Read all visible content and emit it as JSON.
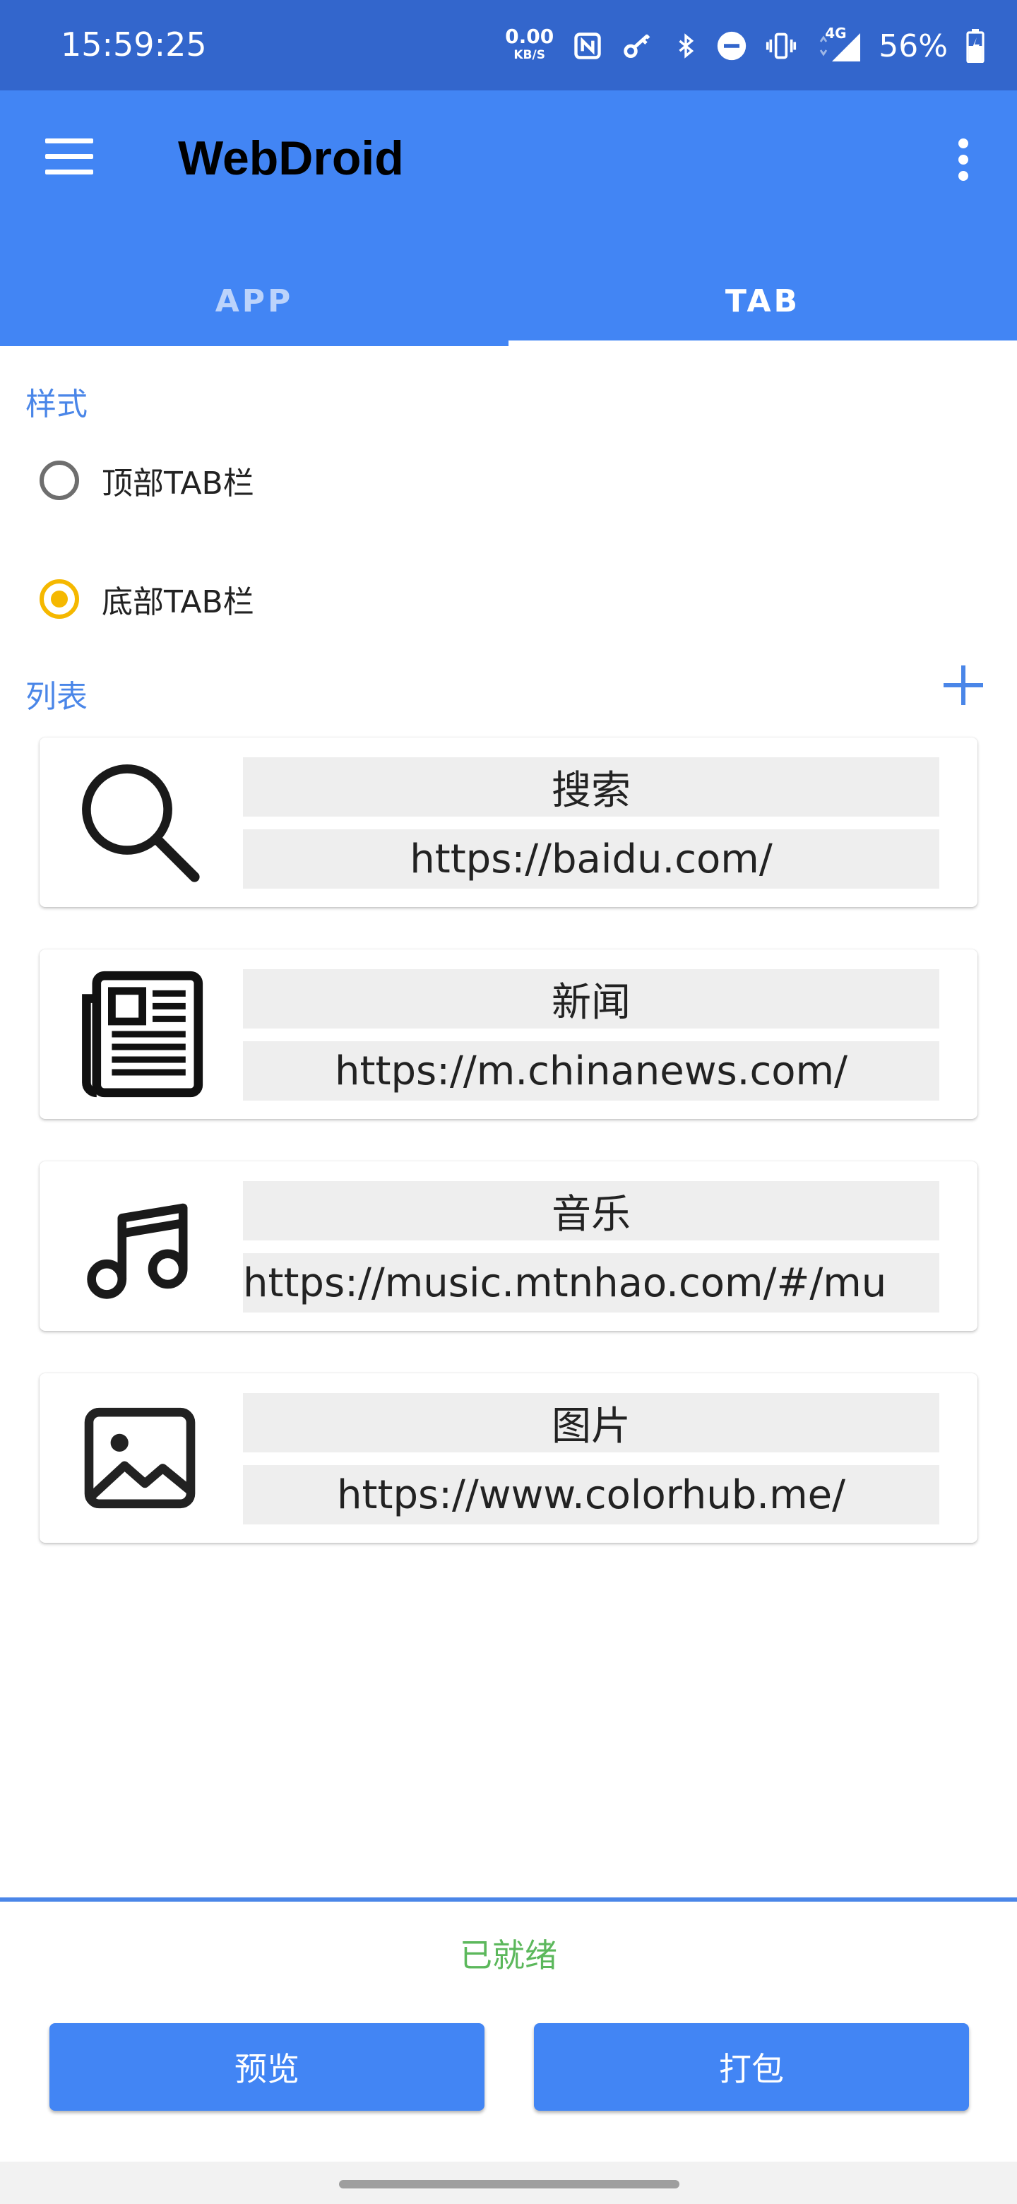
{
  "status_bar": {
    "time": "15:59:25",
    "speed_value": "0.00",
    "speed_unit": "KB/S",
    "network": "4G",
    "battery": "56%",
    "icons": [
      "nfc-icon",
      "key-icon",
      "bluetooth-icon",
      "dnd-icon",
      "vibrate-icon",
      "signal-icon",
      "battery-icon"
    ]
  },
  "toolbar": {
    "title": "WebDroid",
    "colors": {
      "primary": "#4285f4",
      "status_bar": "#3366cc"
    }
  },
  "tabs": [
    {
      "label": "APP",
      "selected": false
    },
    {
      "label": "TAB",
      "selected": true
    }
  ],
  "style_section": {
    "label": "样式",
    "options": [
      {
        "label": "顶部TAB栏",
        "checked": false
      },
      {
        "label": "底部TAB栏",
        "checked": true
      }
    ]
  },
  "list_section": {
    "label": "列表",
    "items": [
      {
        "icon": "search-icon",
        "name": "搜索",
        "url": "https://baidu.com/"
      },
      {
        "icon": "newspaper-icon",
        "name": "新闻",
        "url": "https://m.chinanews.com/"
      },
      {
        "icon": "music-note-icon",
        "name": "音乐",
        "url": "https://music.mtnhao.com/#/mu"
      },
      {
        "icon": "image-icon",
        "name": "图片",
        "url": "https://www.colorhub.me/"
      }
    ]
  },
  "footer": {
    "status": "已就绪",
    "status_color": "#5cb85c",
    "preview_label": "预览",
    "build_label": "打包"
  }
}
